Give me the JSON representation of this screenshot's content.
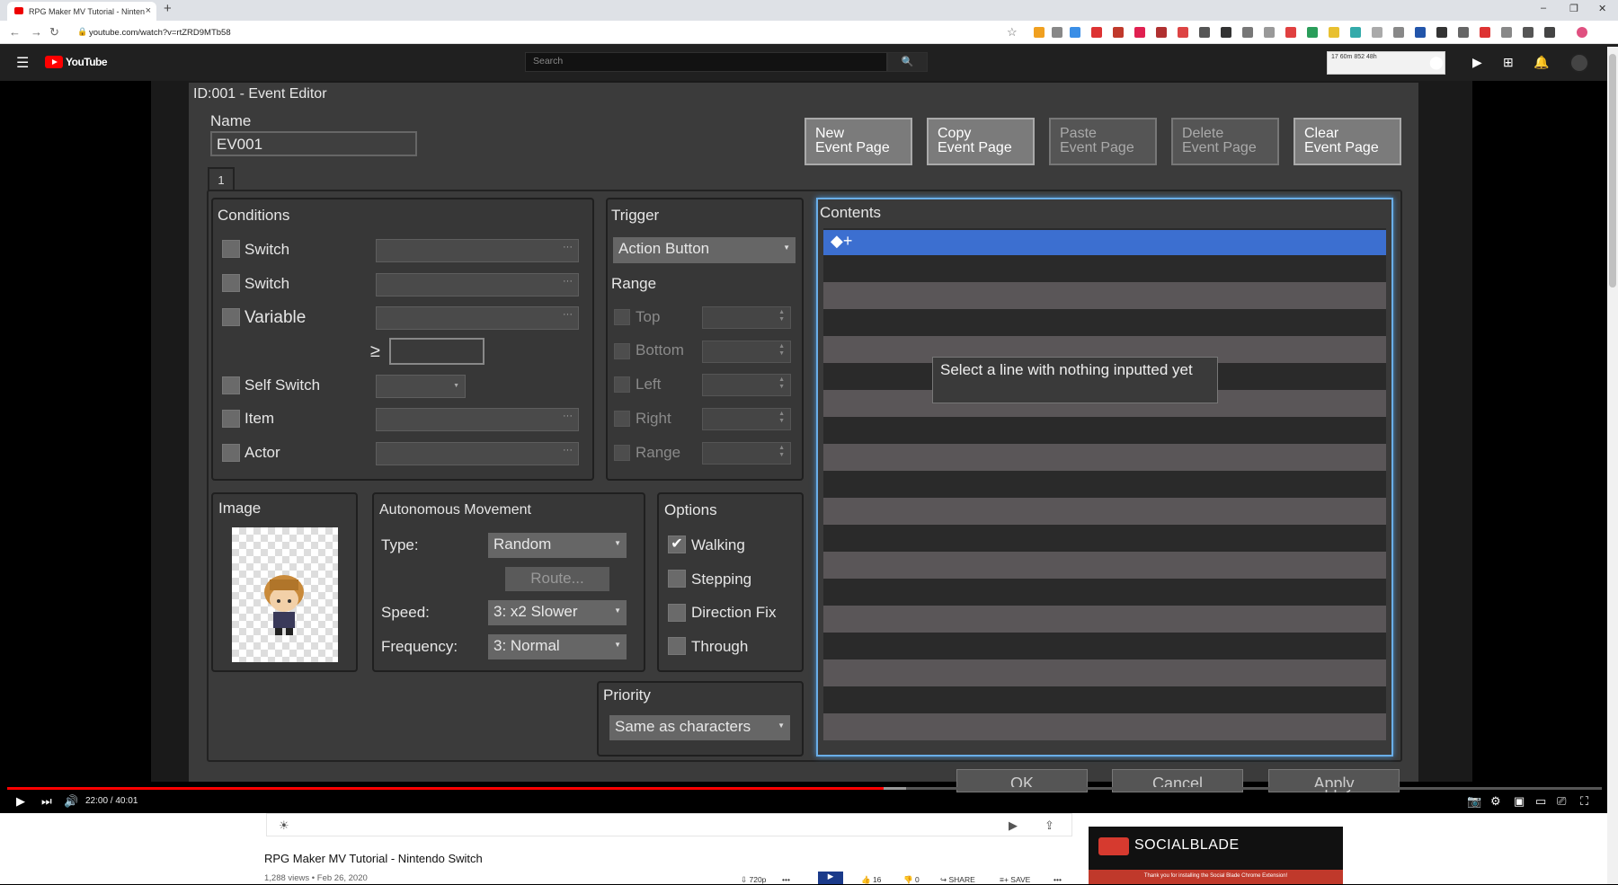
{
  "browser": {
    "tab_title": "RPG Maker MV Tutorial - Ninten",
    "tab_close": "×",
    "new_tab": "+",
    "url": "youtube.com/watch?v=rtZRD9MTb58",
    "win_min": "–",
    "win_max": "❐",
    "win_close": "✕"
  },
  "youtube": {
    "logo_text": "YouTube",
    "search_placeholder": "Search",
    "ext_widget": {
      "val1": "17",
      "sub1": "60m",
      "val2": "852",
      "sub2": "48h"
    }
  },
  "editor": {
    "window_title": "ID:001 - Event Editor",
    "name_label": "Name",
    "name_value": "EV001",
    "page_buttons": [
      {
        "line1": "New",
        "line2": "Event Page",
        "enabled": true
      },
      {
        "line1": "Copy",
        "line2": "Event Page",
        "enabled": true
      },
      {
        "line1": "Paste",
        "line2": "Event Page",
        "enabled": false
      },
      {
        "line1": "Delete",
        "line2": "Event Page",
        "enabled": false
      },
      {
        "line1": "Clear",
        "line2": "Event Page",
        "enabled": true
      }
    ],
    "page_tab": "1",
    "conditions": {
      "title": "Conditions",
      "items": [
        "Switch",
        "Switch",
        "Variable",
        "Self Switch",
        "Item",
        "Actor"
      ],
      "compare_symbol": "≥"
    },
    "trigger": {
      "title": "Trigger",
      "value": "Action Button",
      "range_title": "Range",
      "range_items": [
        "Top",
        "Bottom",
        "Left",
        "Right",
        "Range"
      ]
    },
    "contents": {
      "title": "Contents",
      "first_line": "◆+",
      "tooltip": "Select a line with nothing inputted yet"
    },
    "image": {
      "title": "Image"
    },
    "autonomous": {
      "title": "Autonomous Movement",
      "type_label": "Type:",
      "type_value": "Random",
      "route_button": "Route...",
      "speed_label": "Speed:",
      "speed_value": "3: x2 Slower",
      "freq_label": "Frequency:",
      "freq_value": "3: Normal"
    },
    "options": {
      "title": "Options",
      "items": [
        {
          "label": "Walking",
          "checked": true
        },
        {
          "label": "Stepping",
          "checked": false
        },
        {
          "label": "Direction Fix",
          "checked": false
        },
        {
          "label": "Through",
          "checked": false
        }
      ]
    },
    "priority": {
      "title": "Priority",
      "value": "Same as characters"
    },
    "ok_label": "OK",
    "cancel_label": "Cancel",
    "apply_label": "Apply"
  },
  "player": {
    "time": "22:00 / 40:01",
    "progress_fraction": 0.55
  },
  "video": {
    "title": "RPG Maker MV Tutorial - Nintendo Switch",
    "meta": "1,288 views • Feb 26, 2020",
    "quality": "720p",
    "likes": "16",
    "dislikes": "0",
    "share": "SHARE",
    "save": "SAVE"
  },
  "socialblade": {
    "brand": "SOCIALBLADE",
    "strip": "Thank you for installing the Social Blade Chrome Extension!"
  }
}
